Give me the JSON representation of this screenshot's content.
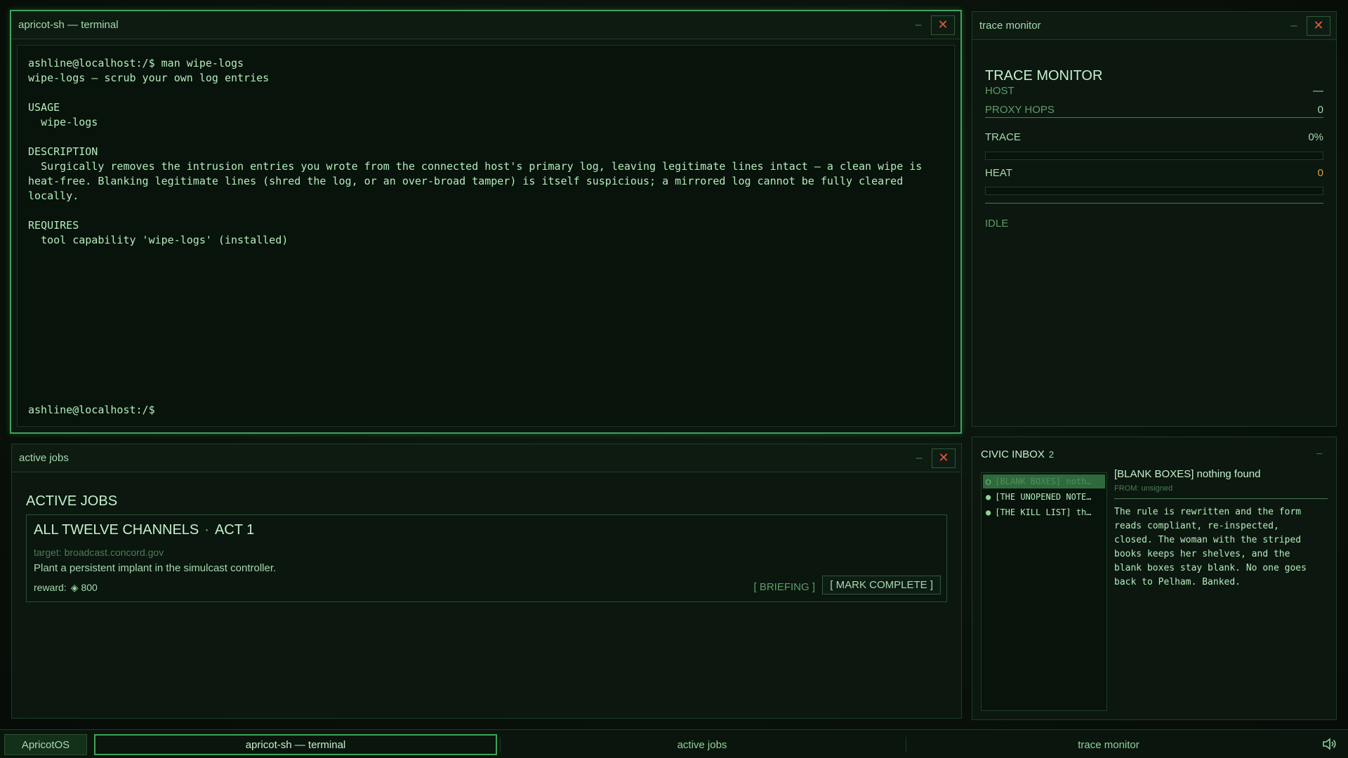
{
  "terminal": {
    "title": "apricot-sh — terminal",
    "lines": [
      "ashline@localhost:/$ man wipe-logs",
      "wipe-logs — scrub your own log entries",
      "",
      "USAGE",
      "  wipe-logs",
      "",
      "DESCRIPTION",
      "  Surgically removes the intrusion entries you wrote from the connected host's primary log, leaving legitimate lines intact — a clean wipe is heat-free. Blanking legitimate lines (shred the log, or an over-broad tamper) is itself suspicious; a mirrored log cannot be fully cleared locally.",
      "",
      "REQUIRES",
      "  tool capability 'wipe-logs' (installed)"
    ],
    "prompt": "ashline@localhost:/$"
  },
  "trace_monitor": {
    "window_title": "trace monitor",
    "heading": "TRACE MONITOR",
    "host_label": "HOST",
    "host_value": "—",
    "proxy_label": "PROXY HOPS",
    "proxy_value": "0",
    "trace_label": "TRACE",
    "trace_value": "0%",
    "trace_fraction": 0,
    "heat_label": "HEAT",
    "heat_value": "0",
    "heat_fraction": 0,
    "status": "IDLE"
  },
  "active_jobs": {
    "window_title": "active jobs",
    "heading": "ACTIVE JOBS",
    "job": {
      "title": "ALL TWELVE CHANNELS",
      "separator": "·",
      "act": "ACT 1",
      "target": "target: broadcast.concord.gov",
      "description": "Plant a persistent implant in the simulcast controller.",
      "reward_label": "reward:",
      "reward_symbol": "◈",
      "reward_value": "800",
      "briefing_label": "[ BRIEFING ]",
      "complete_label": "[ MARK COMPLETE ]"
    }
  },
  "inbox": {
    "title": "CIVIC INBOX",
    "count": "2",
    "items": [
      {
        "label": "[BLANK BOXES] noth…",
        "selected": true
      },
      {
        "label": "[THE UNOPENED NOTE…",
        "selected": false
      },
      {
        "label": "[THE KILL LIST] th…",
        "selected": false
      }
    ],
    "message": {
      "subject": "[BLANK BOXES] nothing found",
      "from": "FROM: unsigned",
      "body": "The rule is rewritten and the form reads compliant, re-inspected, closed. The woman with the striped books keeps her shelves, and the blank boxes stay blank. No one goes back to Pelham. Banked."
    }
  },
  "taskbar": {
    "start_label": "ApricotOS",
    "items": [
      {
        "label": "apricot-sh — terminal",
        "active": true
      },
      {
        "label": "active jobs",
        "active": false
      },
      {
        "label": "trace monitor",
        "active": false
      }
    ]
  },
  "window_controls": {
    "minimize": "–",
    "close": "✕"
  },
  "colors": {
    "accent": "#3fa35a",
    "text": "#b4ecbc",
    "close": "#e25a3c",
    "heat": "#d9a23c"
  }
}
